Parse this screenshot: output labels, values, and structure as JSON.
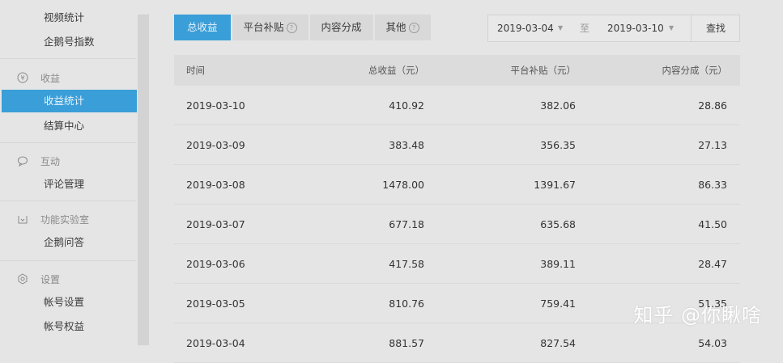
{
  "sidebar": {
    "top_items": [
      {
        "label": "视频统计"
      },
      {
        "label": "企鹅号指数"
      }
    ],
    "groups": [
      {
        "title": "收益",
        "icon": "yuan-circle-icon",
        "items": [
          {
            "label": "收益统计",
            "active": true
          },
          {
            "label": "结算中心",
            "active": false
          }
        ]
      },
      {
        "title": "互动",
        "icon": "chat-bubble-icon",
        "items": [
          {
            "label": "评论管理",
            "active": false
          }
        ]
      },
      {
        "title": "功能实验室",
        "icon": "lab-icon",
        "items": [
          {
            "label": "企鹅问答",
            "active": false
          }
        ]
      },
      {
        "title": "设置",
        "icon": "gear-icon",
        "items": [
          {
            "label": "帐号设置",
            "active": false
          },
          {
            "label": "帐号权益",
            "active": false
          }
        ]
      }
    ]
  },
  "tabs": [
    {
      "label": "总收益",
      "active": true,
      "help": false
    },
    {
      "label": "平台补贴",
      "active": false,
      "help": true
    },
    {
      "label": "内容分成",
      "active": false,
      "help": false
    },
    {
      "label": "其他",
      "active": false,
      "help": true
    }
  ],
  "date_range": {
    "start": "2019-03-04",
    "separator": "至",
    "end": "2019-03-10",
    "search_label": "查找"
  },
  "table": {
    "headers": [
      "时间",
      "总收益（元）",
      "平台补贴（元）",
      "内容分成（元）"
    ],
    "rows": [
      [
        "2019-03-10",
        "410.92",
        "382.06",
        "28.86"
      ],
      [
        "2019-03-09",
        "383.48",
        "356.35",
        "27.13"
      ],
      [
        "2019-03-08",
        "1478.00",
        "1391.67",
        "86.33"
      ],
      [
        "2019-03-07",
        "677.18",
        "635.68",
        "41.50"
      ],
      [
        "2019-03-06",
        "417.58",
        "389.11",
        "28.47"
      ],
      [
        "2019-03-05",
        "810.76",
        "759.41",
        "51.35"
      ],
      [
        "2019-03-04",
        "881.57",
        "827.54",
        "54.03"
      ]
    ]
  },
  "watermark": "知乎 @你瞅啥",
  "colors": {
    "accent": "#3a9ed8",
    "background": "#e5e5e5"
  }
}
